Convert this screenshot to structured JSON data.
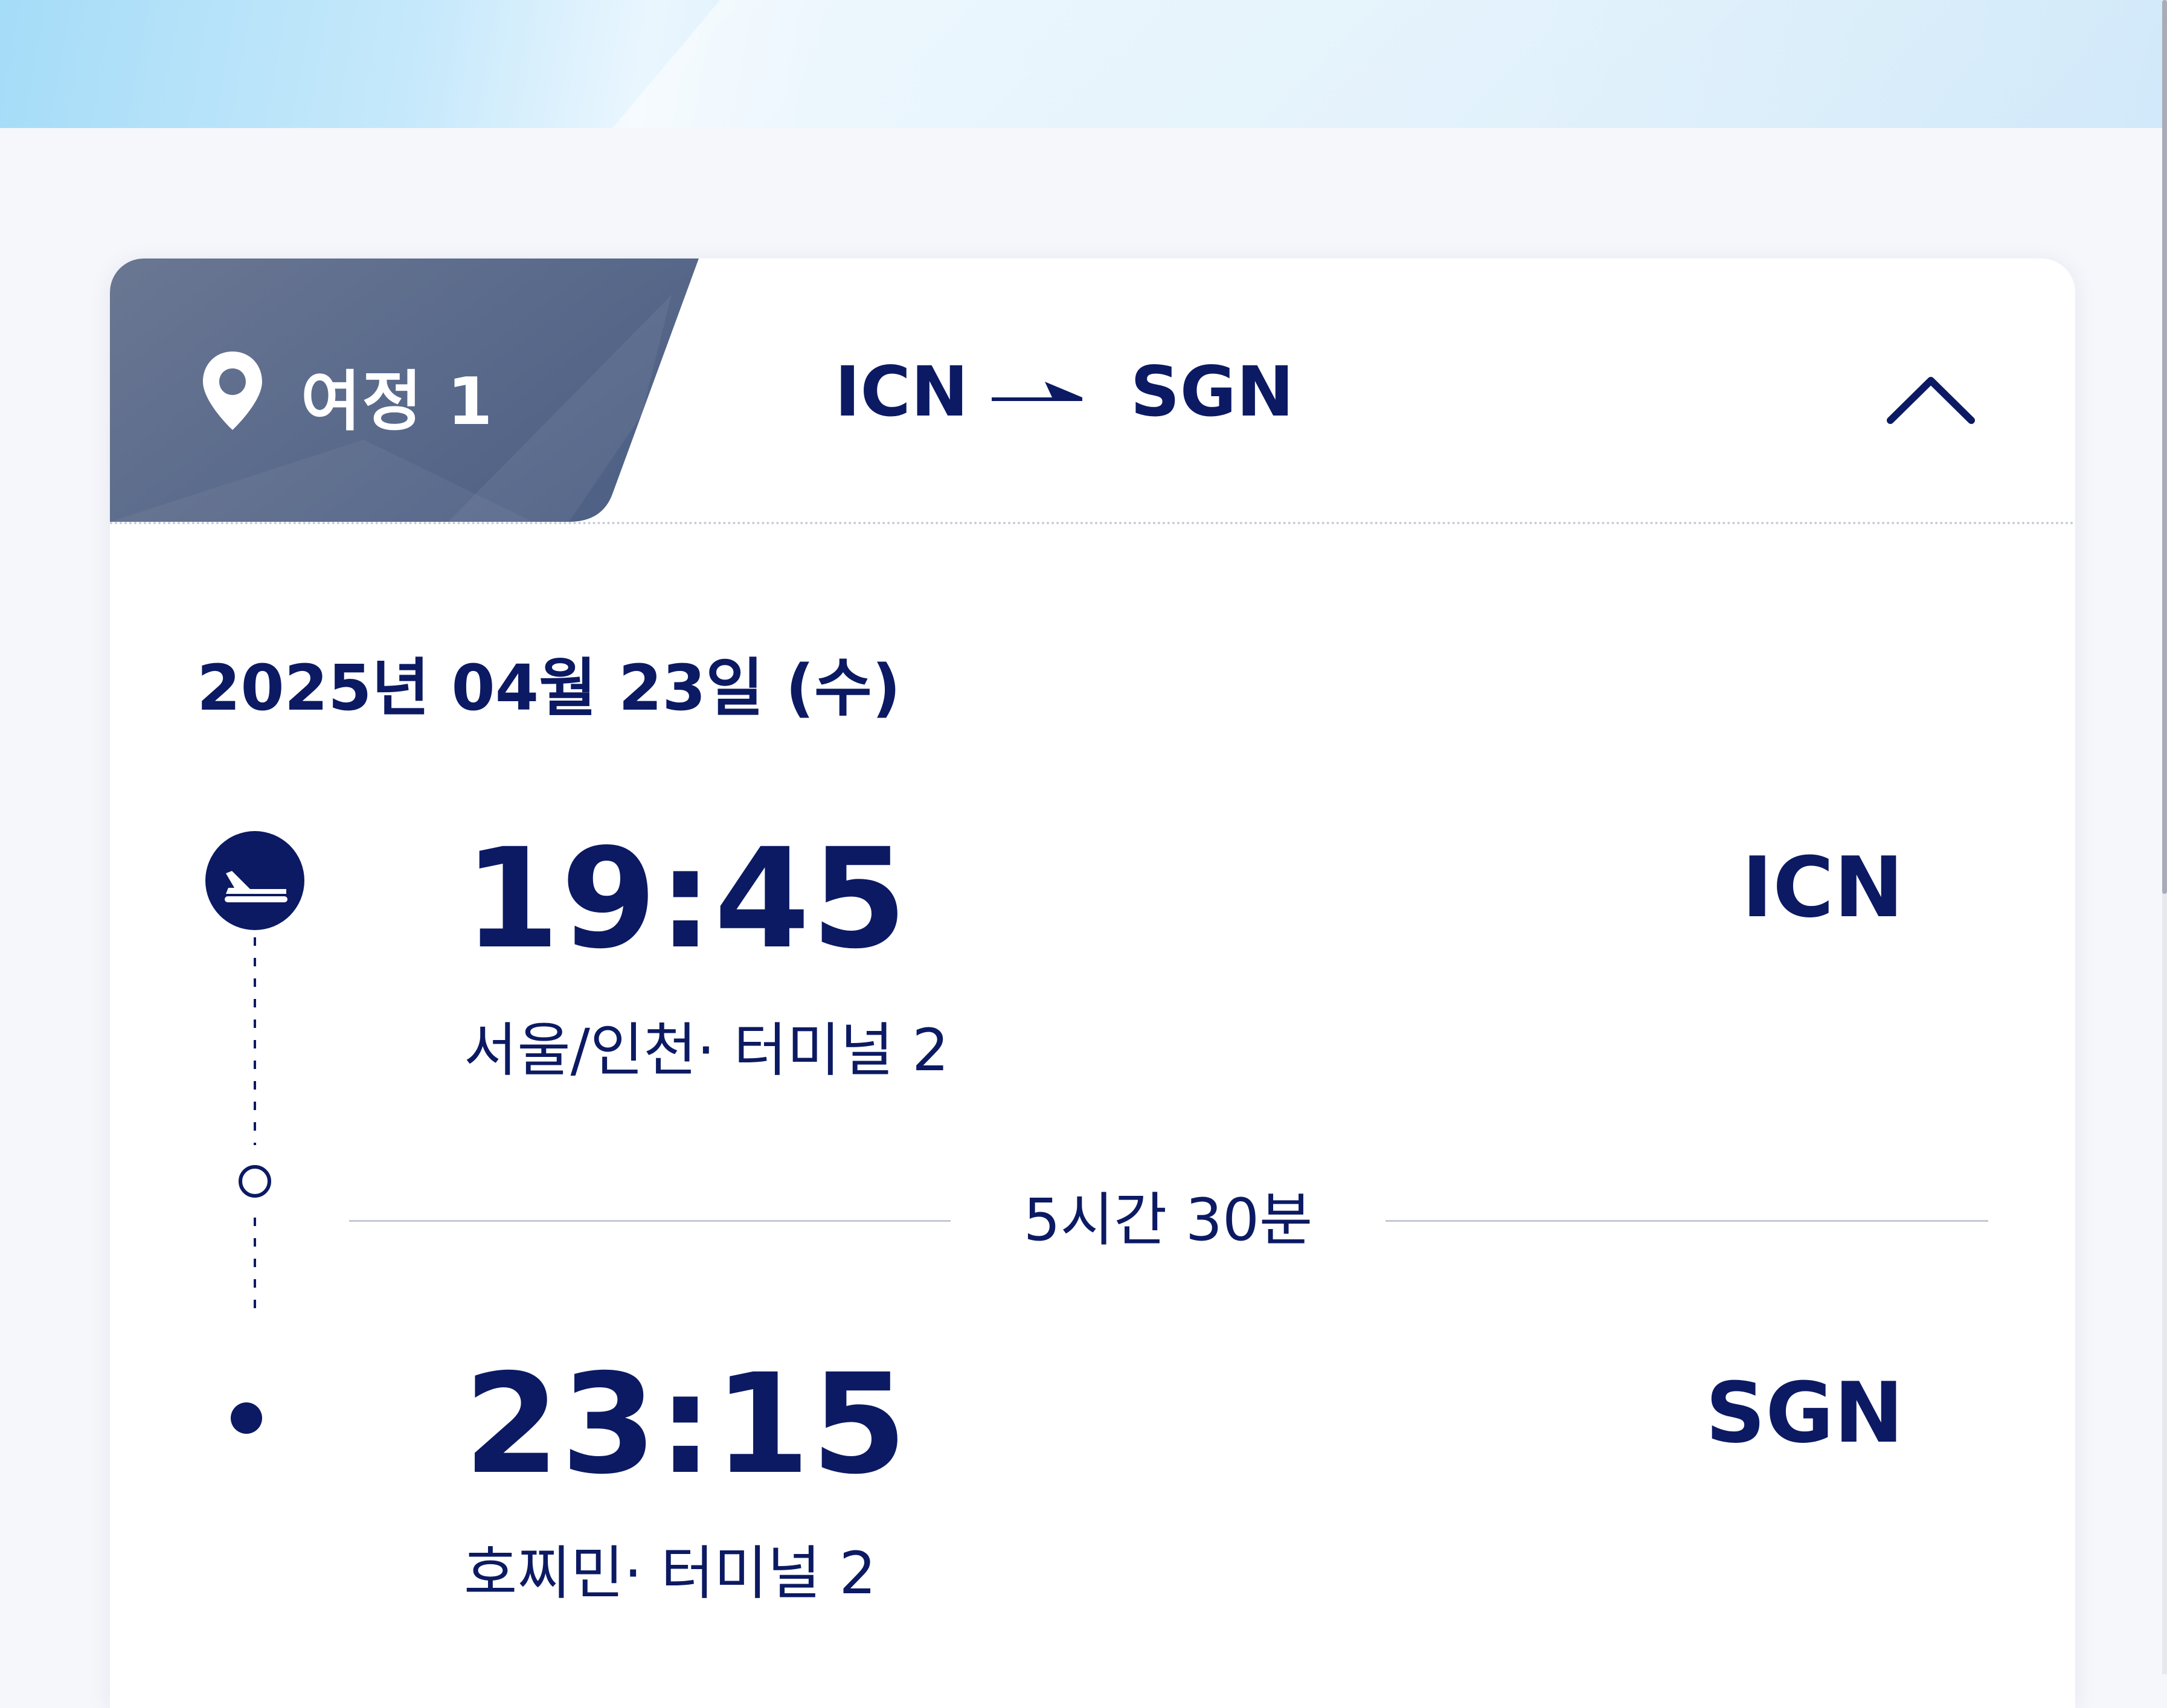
{
  "journey": {
    "label": "여정 1",
    "origin": "ICN",
    "destination": "SGN",
    "expanded": true
  },
  "flight": {
    "date": "2025년 04월 23일 (수)",
    "departure": {
      "time": "19:45",
      "code": "ICN",
      "city_terminal": "서울/인천· 터미널   2"
    },
    "duration": "5시간 30분",
    "arrival": {
      "time": "23:15",
      "code": "SGN",
      "city_terminal": "호찌민· 터미널   2"
    }
  },
  "icons": {
    "location": "location-pin-icon",
    "route_arrow": "plane-arrow-icon",
    "collapse": "chevron-up-icon",
    "departure": "takeoff-icon"
  },
  "colors": {
    "navy": "#0c1a63",
    "tab": "#5d6d8d",
    "card": "#ffffff",
    "page_bg": "#f6f7fb",
    "banner": "#c7e9fb"
  }
}
